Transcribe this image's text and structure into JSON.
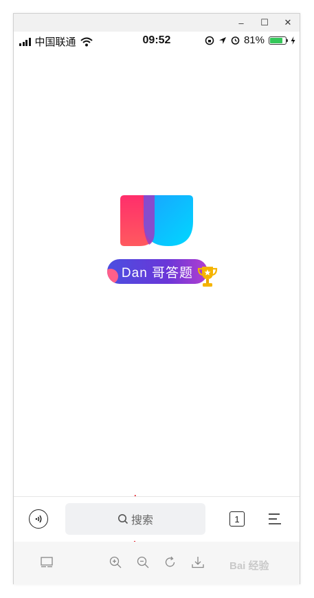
{
  "titlebar": {
    "minimize_label": "–",
    "maximize_label": "☐",
    "close_label": "✕"
  },
  "statusbar": {
    "carrier": "中国联通",
    "time": "09:52",
    "battery_percent": "81%",
    "battery_level": 0.81,
    "icons": [
      "signal-icon",
      "wifi-icon",
      "rotation-lock-icon",
      "location-icon",
      "alarm-icon",
      "battery-icon",
      "charging-icon"
    ]
  },
  "content": {
    "badge_text": "Dan 哥答题",
    "colors": {
      "logo_red": "#ff3d6b",
      "logo_blue": "#00c2ff",
      "badge_purple": "#5b3fdc",
      "arrow_red": "#e0141e"
    }
  },
  "bottombar": {
    "search_placeholder": "搜索",
    "tab_count": "1",
    "icons": [
      "voice-icon",
      "search-icon",
      "tabs-icon",
      "menu-icon"
    ]
  },
  "viewer": {
    "icons": [
      "window-icon",
      "zoom-in-icon",
      "zoom-out-icon",
      "rotate-icon",
      "download-icon"
    ]
  },
  "watermark": "Bai 经验"
}
